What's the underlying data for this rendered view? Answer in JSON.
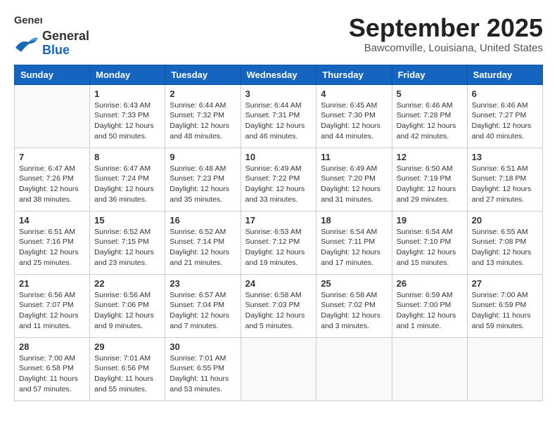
{
  "header": {
    "logo_line1": "General",
    "logo_line2": "Blue",
    "month": "September 2025",
    "location": "Bawcomville, Louisiana, United States"
  },
  "days_of_week": [
    "Sunday",
    "Monday",
    "Tuesday",
    "Wednesday",
    "Thursday",
    "Friday",
    "Saturday"
  ],
  "weeks": [
    [
      {
        "day": "",
        "info": ""
      },
      {
        "day": "1",
        "info": "Sunrise: 6:43 AM\nSunset: 7:33 PM\nDaylight: 12 hours\nand 50 minutes."
      },
      {
        "day": "2",
        "info": "Sunrise: 6:44 AM\nSunset: 7:32 PM\nDaylight: 12 hours\nand 48 minutes."
      },
      {
        "day": "3",
        "info": "Sunrise: 6:44 AM\nSunset: 7:31 PM\nDaylight: 12 hours\nand 46 minutes."
      },
      {
        "day": "4",
        "info": "Sunrise: 6:45 AM\nSunset: 7:30 PM\nDaylight: 12 hours\nand 44 minutes."
      },
      {
        "day": "5",
        "info": "Sunrise: 6:46 AM\nSunset: 7:28 PM\nDaylight: 12 hours\nand 42 minutes."
      },
      {
        "day": "6",
        "info": "Sunrise: 6:46 AM\nSunset: 7:27 PM\nDaylight: 12 hours\nand 40 minutes."
      }
    ],
    [
      {
        "day": "7",
        "info": "Sunrise: 6:47 AM\nSunset: 7:26 PM\nDaylight: 12 hours\nand 38 minutes."
      },
      {
        "day": "8",
        "info": "Sunrise: 6:47 AM\nSunset: 7:24 PM\nDaylight: 12 hours\nand 36 minutes."
      },
      {
        "day": "9",
        "info": "Sunrise: 6:48 AM\nSunset: 7:23 PM\nDaylight: 12 hours\nand 35 minutes."
      },
      {
        "day": "10",
        "info": "Sunrise: 6:49 AM\nSunset: 7:22 PM\nDaylight: 12 hours\nand 33 minutes."
      },
      {
        "day": "11",
        "info": "Sunrise: 6:49 AM\nSunset: 7:20 PM\nDaylight: 12 hours\nand 31 minutes."
      },
      {
        "day": "12",
        "info": "Sunrise: 6:50 AM\nSunset: 7:19 PM\nDaylight: 12 hours\nand 29 minutes."
      },
      {
        "day": "13",
        "info": "Sunrise: 6:51 AM\nSunset: 7:18 PM\nDaylight: 12 hours\nand 27 minutes."
      }
    ],
    [
      {
        "day": "14",
        "info": "Sunrise: 6:51 AM\nSunset: 7:16 PM\nDaylight: 12 hours\nand 25 minutes."
      },
      {
        "day": "15",
        "info": "Sunrise: 6:52 AM\nSunset: 7:15 PM\nDaylight: 12 hours\nand 23 minutes."
      },
      {
        "day": "16",
        "info": "Sunrise: 6:52 AM\nSunset: 7:14 PM\nDaylight: 12 hours\nand 21 minutes."
      },
      {
        "day": "17",
        "info": "Sunrise: 6:53 AM\nSunset: 7:12 PM\nDaylight: 12 hours\nand 19 minutes."
      },
      {
        "day": "18",
        "info": "Sunrise: 6:54 AM\nSunset: 7:11 PM\nDaylight: 12 hours\nand 17 minutes."
      },
      {
        "day": "19",
        "info": "Sunrise: 6:54 AM\nSunset: 7:10 PM\nDaylight: 12 hours\nand 15 minutes."
      },
      {
        "day": "20",
        "info": "Sunrise: 6:55 AM\nSunset: 7:08 PM\nDaylight: 12 hours\nand 13 minutes."
      }
    ],
    [
      {
        "day": "21",
        "info": "Sunrise: 6:56 AM\nSunset: 7:07 PM\nDaylight: 12 hours\nand 11 minutes."
      },
      {
        "day": "22",
        "info": "Sunrise: 6:56 AM\nSunset: 7:06 PM\nDaylight: 12 hours\nand 9 minutes."
      },
      {
        "day": "23",
        "info": "Sunrise: 6:57 AM\nSunset: 7:04 PM\nDaylight: 12 hours\nand 7 minutes."
      },
      {
        "day": "24",
        "info": "Sunrise: 6:58 AM\nSunset: 7:03 PM\nDaylight: 12 hours\nand 5 minutes."
      },
      {
        "day": "25",
        "info": "Sunrise: 6:58 AM\nSunset: 7:02 PM\nDaylight: 12 hours\nand 3 minutes."
      },
      {
        "day": "26",
        "info": "Sunrise: 6:59 AM\nSunset: 7:00 PM\nDaylight: 12 hours\nand 1 minute."
      },
      {
        "day": "27",
        "info": "Sunrise: 7:00 AM\nSunset: 6:59 PM\nDaylight: 11 hours\nand 59 minutes."
      }
    ],
    [
      {
        "day": "28",
        "info": "Sunrise: 7:00 AM\nSunset: 6:58 PM\nDaylight: 11 hours\nand 57 minutes."
      },
      {
        "day": "29",
        "info": "Sunrise: 7:01 AM\nSunset: 6:56 PM\nDaylight: 11 hours\nand 55 minutes."
      },
      {
        "day": "30",
        "info": "Sunrise: 7:01 AM\nSunset: 6:55 PM\nDaylight: 11 hours\nand 53 minutes."
      },
      {
        "day": "",
        "info": ""
      },
      {
        "day": "",
        "info": ""
      },
      {
        "day": "",
        "info": ""
      },
      {
        "day": "",
        "info": ""
      }
    ]
  ]
}
